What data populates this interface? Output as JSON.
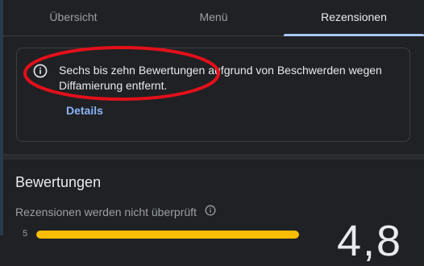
{
  "tabs": [
    {
      "label": "Übersicht",
      "active": false
    },
    {
      "label": "Menü",
      "active": false
    },
    {
      "label": "Rezensionen",
      "active": true
    }
  ],
  "notice": {
    "icon": "info-icon",
    "text": "Sechs bis zehn Bewertungen aufgrund von Beschwerden wegen Diffamierung entfernt.",
    "link_label": "Details"
  },
  "ratings": {
    "title": "Bewertungen",
    "subtitle": "Rezensionen werden nicht überprüft",
    "rows": [
      {
        "stars": "5",
        "fraction": 1.0
      }
    ],
    "average_partial": "4,8"
  },
  "colors": {
    "background": "#202124",
    "accent": "#8ab4f8",
    "tab_indicator": "#a8c7fa",
    "bar_fill": "#fbbc04",
    "annotation": "#e3101a"
  }
}
